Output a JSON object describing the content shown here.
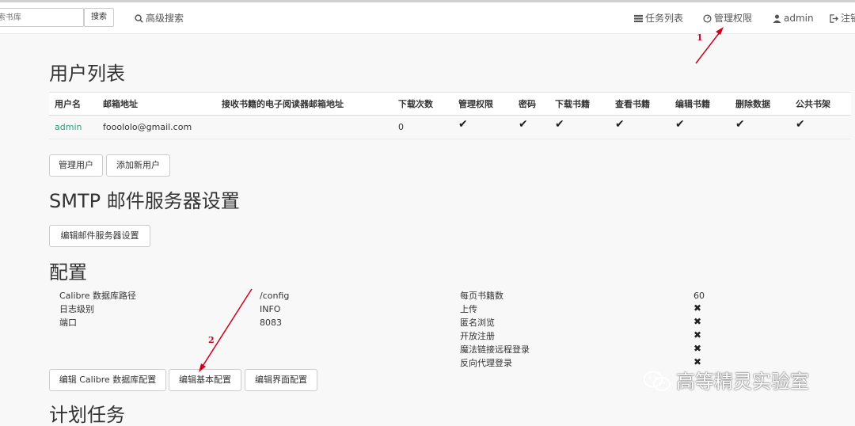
{
  "navbar": {
    "search_placeholder": "索书库",
    "search_button": "搜索",
    "advanced_search": "高级搜索",
    "tasks": "任务列表",
    "admin_permission": "管理权限",
    "user": "admin",
    "logout": "注销"
  },
  "users": {
    "title": "用户列表",
    "headers": [
      "用户名",
      "邮箱地址",
      "接收书籍的电子阅读器邮箱地址",
      "下载次数",
      "管理权限",
      "密码",
      "下载书籍",
      "查看书籍",
      "编辑书籍",
      "删除数据",
      "公共书架"
    ],
    "row": {
      "username": "admin",
      "email": "fooololo@gmail.com",
      "kindle_email": "",
      "downloads": "0",
      "perm_glyph": "✔"
    },
    "manage_button": "管理用户",
    "add_button": "添加新用户"
  },
  "smtp": {
    "title": "SMTP 邮件服务器设置",
    "edit_button": "编辑邮件服务器设置"
  },
  "config": {
    "title": "配置",
    "left": [
      {
        "label": "Calibre 数据库路径",
        "value": "/config"
      },
      {
        "label": "日志级别",
        "value": "INFO"
      },
      {
        "label": "端口",
        "value": "8083"
      }
    ],
    "right": [
      {
        "label": "每页书籍数",
        "value": "60"
      },
      {
        "label": "上传",
        "value": "✖"
      },
      {
        "label": "匿名浏览",
        "value": "✖"
      },
      {
        "label": "开放注册",
        "value": "✖"
      },
      {
        "label": "魔法链接远程登录",
        "value": "✖"
      },
      {
        "label": "反向代理登录",
        "value": "✖"
      }
    ],
    "buttons": [
      "编辑 Calibre 数据库配置",
      "编辑基本配置",
      "编辑界面配置"
    ]
  },
  "scheduled": {
    "title": "计划任务"
  },
  "annotations": {
    "arrow1_label": "1",
    "arrow2_label": "2",
    "color": "#d0021b"
  },
  "watermark": {
    "text": "高等精灵实验室",
    "icon": "wechat-icon"
  }
}
